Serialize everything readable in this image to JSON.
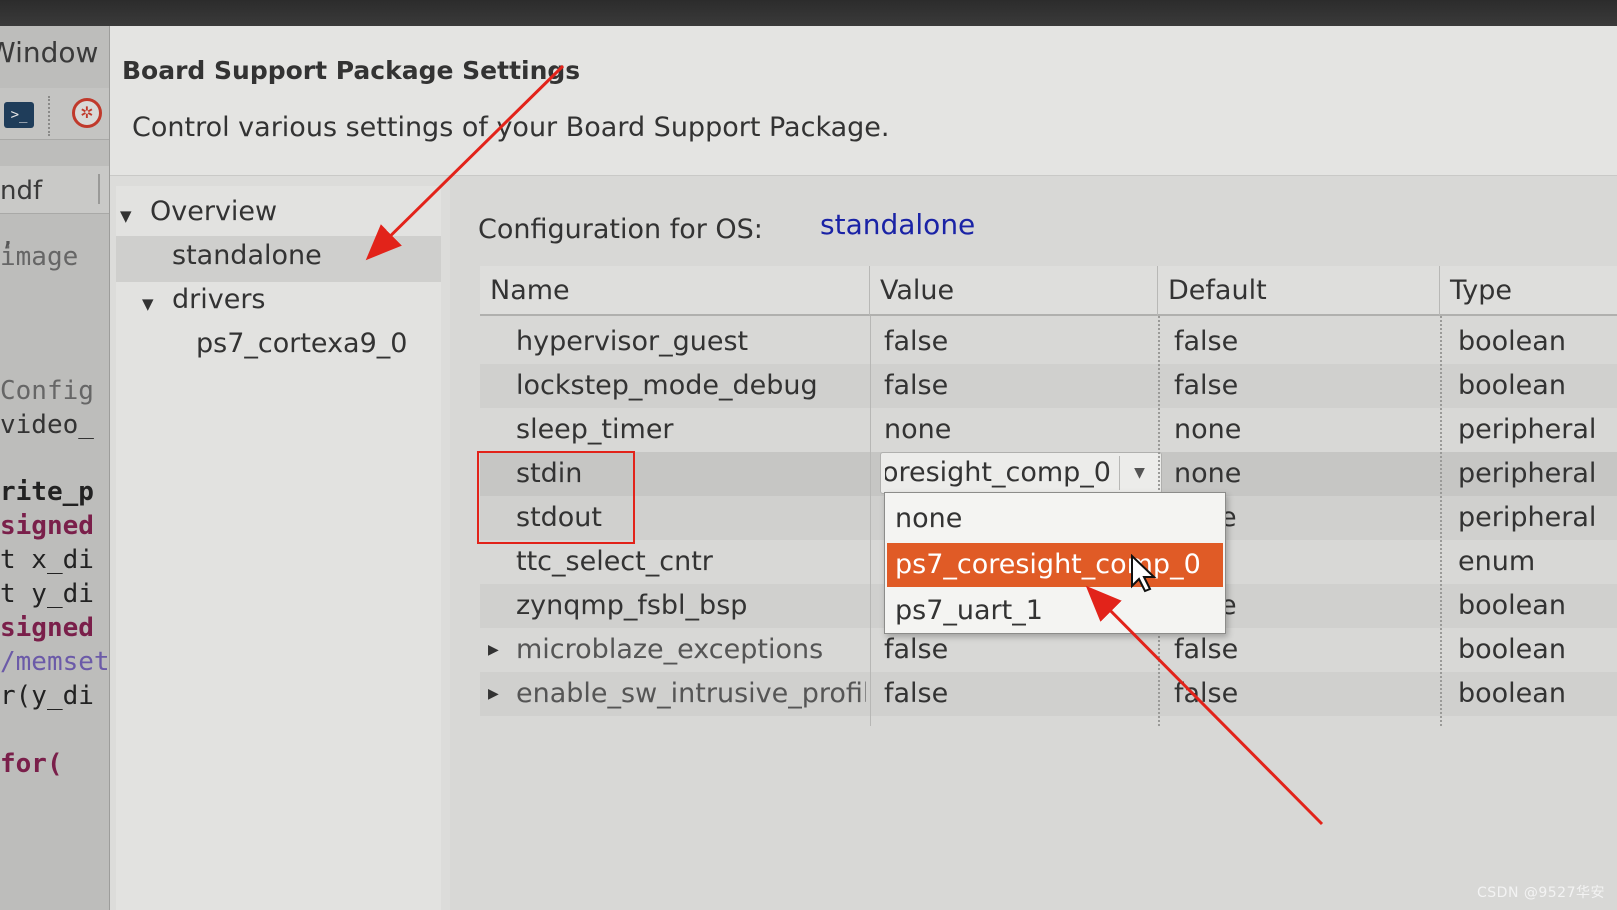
{
  "ide": {
    "menu_fragment": "Window",
    "tab_fragment": "ndf",
    "code_lines": [
      "  ,",
      " image",
      "",
      " Config",
      " video_",
      "",
      "rite_p",
      "signed",
      "t x_di",
      "t y_di",
      "signed",
      "/memset",
      "r(y_di",
      "",
      "  for("
    ]
  },
  "dialog": {
    "title": "Board Support Package Settings",
    "description": "Control various settings of your Board Support Package."
  },
  "tree": {
    "overview": "Overview",
    "standalone": "standalone",
    "drivers": "drivers",
    "processor": "ps7_cortexa9_0"
  },
  "config": {
    "os_label": "Configuration for OS:",
    "os_value": "standalone",
    "columns": [
      "Name",
      "Value",
      "Default",
      "Type"
    ],
    "rows": [
      {
        "name": "hypervisor_guest",
        "value": "false",
        "default": "false",
        "type": "boolean"
      },
      {
        "name": "lockstep_mode_debug",
        "value": "false",
        "default": "false",
        "type": "boolean"
      },
      {
        "name": "sleep_timer",
        "value": "none",
        "default": "none",
        "type": "peripheral"
      },
      {
        "name": "stdin",
        "value": "ps7_coresight_comp_0",
        "default": "none",
        "type": "peripheral"
      },
      {
        "name": "stdout",
        "value": "",
        "default": "none",
        "type": "peripheral"
      },
      {
        "name": "ttc_select_cntr",
        "value": "",
        "default": "",
        "type": "enum"
      },
      {
        "name": "zynqmp_fsbl_bsp",
        "value": "",
        "default": "none",
        "type": "boolean"
      },
      {
        "name": "microblaze_exceptions",
        "value": "false",
        "default": "false",
        "type": "boolean"
      },
      {
        "name": "enable_sw_intrusive_profiling",
        "value": "false",
        "default": "false",
        "type": "boolean"
      }
    ]
  },
  "dropdown": {
    "options": [
      "none",
      "ps7_coresight_comp_0",
      "ps7_uart_1"
    ],
    "highlighted_index": 1
  },
  "colors": {
    "highlight": "#e05b26",
    "link": "#1a23a6",
    "annotation": "#e2231a"
  },
  "icons": [
    "terminal-icon",
    "debug-icon",
    "expand-triangle-icon",
    "collapse-triangle-icon",
    "dropdown-arrow-icon",
    "mouse-pointer-icon"
  ],
  "watermark": "CSDN @9527华安"
}
